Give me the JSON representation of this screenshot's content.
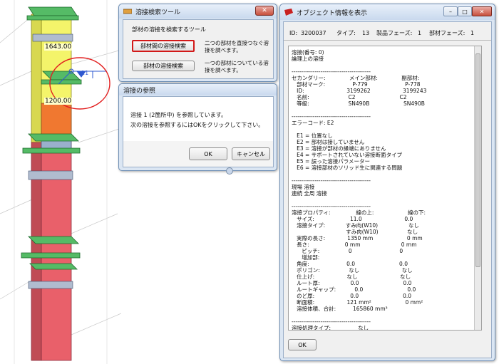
{
  "viewport": {
    "dim_top": "1643.00",
    "dim_mid": "1200.00",
    "weld_mark": "11"
  },
  "search_tool": {
    "title": "溶接検索ツール",
    "group_label": "部材の溶接を検索するツール",
    "btn_between": "部材間の溶接検索",
    "desc_between_1": "二つの部材を直接つなぐ溶",
    "desc_between_2": "接を調べます。",
    "btn_member": "部材の溶接検索",
    "desc_member_1": "一つの部材についている溶",
    "desc_member_2": "接を調べます。"
  },
  "weld_ref": {
    "title": "溶接の参照",
    "msg1": "溶接 1 (2箇所中) を参照しています。",
    "msg2": "次の溶接を参照するにはOKをクリックして下さい。",
    "ok": "OK",
    "cancel": "キャンセル"
  },
  "object_info": {
    "title": "オブジェクト情報を表示",
    "id_label": "ID:",
    "id_value": "3200037",
    "type_label": "タイプ:",
    "type_value": "13",
    "phase_label": "製品フェーズ:",
    "phase_value": "1",
    "mphase_label": "部材フェーズ:",
    "mphase_value": "1",
    "ok": "OK",
    "lines": [
      "溶接(番号: 0)",
      "論理上の溶接",
      "",
      "-----------------------------------------",
      "セカンダリー:              メイン部材:              副部材:",
      "   部材マーク:                P-779                      P-778",
      "   ID:                         3199262                   3199243",
      "   名前:                       C2                          C2",
      "   等級:                       SN490B                    SN490B",
      "",
      "-----------------------------------------",
      "エラーコード: E2",
      "",
      "   E1 = 位置なし",
      "   E2 = 部材は接していません",
      "   E3 = 溶接が部材の縁端にありません",
      "   E4 = サポートされていない溶接断面タイプ",
      "   E5 = 誤った溶接パラメーター",
      "   E6 = 溶接部材のソリッド生に関連する問題",
      "",
      "-----------------------------------------",
      "現場 溶接",
      "連続 全周 溶接",
      "",
      "-----------------------------------------",
      "溶接プロパティ:               線の上:                    線の下:",
      "   サイズ:                     11.0                         0.0",
      "   溶接タイプ:            すみ肉(W10)                  なし",
      "                                すみ肉(W10)                 なし",
      "   実際の長さ:             1350 mm                    0 mm",
      "   長さ:                     0 mm                        0 mm",
      "      ピッチ:                 0                            0",
      "      増加部:",
      "   角度:                      0.0                          0.0",
      "   ポリゴン:                 なし                         なし",
      "   仕上げ:                   なし                         なし",
      "   ルート厚:                  0.0                          0.0",
      "   ルートギャップ:           0.0                          0.0",
      "   のど厚:                     0.0                          0.0",
      "   断面積:                   121 mm²                    0 mm²",
      "   溶接体積、合計:          165860 mm³",
      "",
      "-----------------------------------------",
      "溶接処理タイプ:                なし"
    ]
  }
}
